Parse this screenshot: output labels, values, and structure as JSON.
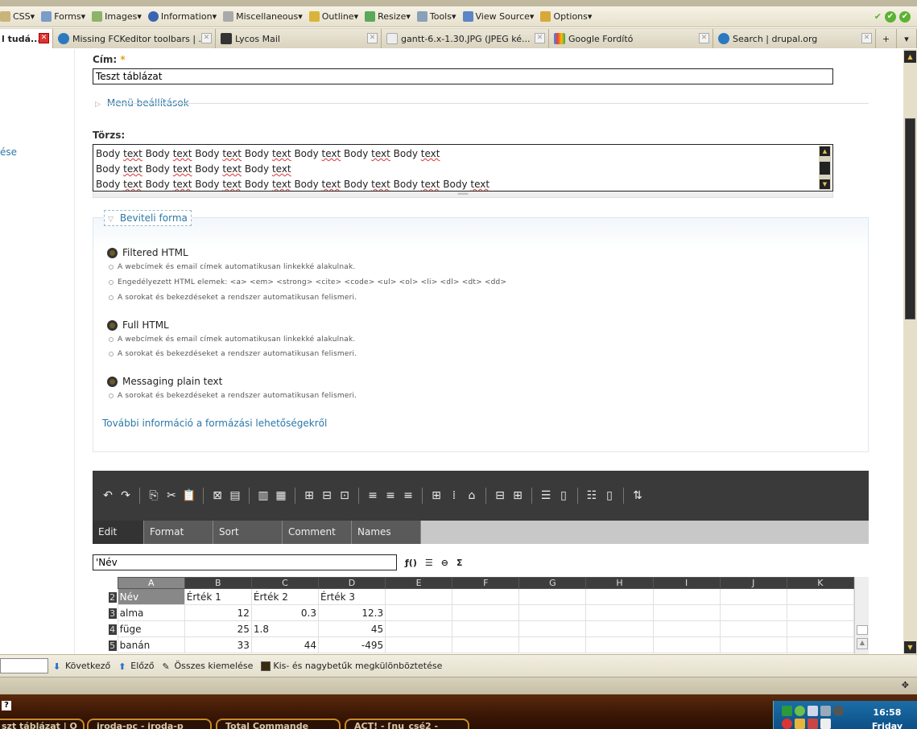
{
  "browser_toolbar": {
    "items": [
      "CSS",
      "Forms",
      "Images",
      "Information",
      "Miscellaneous",
      "Outline",
      "Resize",
      "Tools",
      "View Source",
      "Options"
    ]
  },
  "tabs": [
    {
      "label": "l tudá...",
      "active": true
    },
    {
      "label": "Missing FCKeditor toolbars | ..."
    },
    {
      "label": "Lycos Mail"
    },
    {
      "label": "gantt-6.x-1.30.JPG (JPEG ké..."
    },
    {
      "label": "Google Fordító"
    },
    {
      "label": "Search | drupal.org"
    }
  ],
  "left_link": "ése",
  "form": {
    "title_label": "Cím:",
    "required_mark": "*",
    "title_value": "Teszt táblázat",
    "menu_settings": "Menü beállítások",
    "body_label": "Törzs:",
    "body_lines": [
      "Body text Body text Body text Body text Body text Body text Body text",
      "Body text Body text Body text Body text",
      "Body text Body text Body text Body text Body text Body text Body text Body text"
    ],
    "input_format_legend": "Beviteli forma",
    "formats": [
      {
        "name": "Filtered HTML",
        "tips": [
          "A webcímek és email címek automatikusan linkekké alakulnak.",
          "Engedélyezett HTML elemek: <a> <em> <strong> <cite> <code> <ul> <ol> <li> <dl> <dt> <dd>",
          "A sorokat és bekezdéseket a rendszer automatikusan felismeri."
        ]
      },
      {
        "name": "Full HTML",
        "tips": [
          "A webcímek és email címek automatikusan linkekké alakulnak.",
          "A sorokat és bekezdéseket a rendszer automatikusan felismeri."
        ]
      },
      {
        "name": "Messaging plain text",
        "tips": [
          "A sorokat és bekezdéseket a rendszer automatikusan felismeri."
        ]
      }
    ],
    "more_info_link": "További információ a formázási lehetőségekről"
  },
  "spreadsheet": {
    "tabs": [
      "Edit",
      "Format",
      "Sort",
      "Comment",
      "Names"
    ],
    "active_tab": "Edit",
    "cell_value": "'Név",
    "columns": [
      "A",
      "B",
      "C",
      "D",
      "E",
      "F",
      "G",
      "H",
      "I",
      "J",
      "K"
    ],
    "rows": [
      {
        "num": "2",
        "cells": [
          "Név",
          "Érték 1",
          "Érték 2",
          "Érték 3",
          "",
          "",
          "",
          "",
          "",
          "",
          ""
        ]
      },
      {
        "num": "3",
        "cells": [
          "alma",
          "12",
          "0.3",
          "12.3",
          "",
          "",
          "",
          "",
          "",
          "",
          ""
        ]
      },
      {
        "num": "4",
        "cells": [
          "füge",
          "25",
          "1.8",
          "45",
          "",
          "",
          "",
          "",
          "",
          "",
          ""
        ]
      },
      {
        "num": "5",
        "cells": [
          "banán",
          "33",
          "44",
          "-495",
          "",
          "",
          "",
          "",
          "",
          "",
          ""
        ]
      }
    ]
  },
  "findbar": {
    "next": "Következő",
    "prev": "Előző",
    "highlight_all": "Összes kiemelése",
    "match_case": "Kis- és nagybetűk megkülönböztetése"
  },
  "taskbar": {
    "tasks": [
      "szt táblázat | O",
      "iroda-pc - iroda-p",
      "Total Commande",
      "ACT! - [nu_csé2 -"
    ],
    "clock": "16:58",
    "day": "Friday"
  }
}
